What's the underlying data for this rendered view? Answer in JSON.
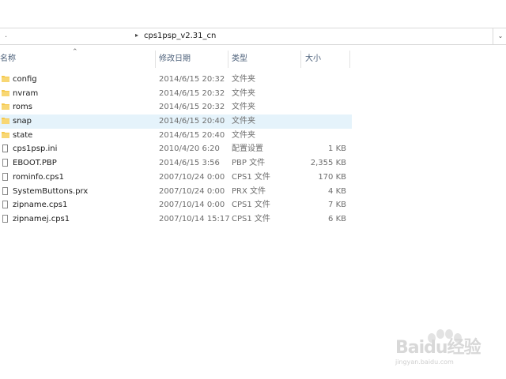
{
  "address": {
    "separator": ".",
    "path": "cps1psp_v2.31_cn"
  },
  "columns": {
    "name": "名称",
    "date": "修改日期",
    "type": "类型",
    "size": "大小"
  },
  "files": [
    {
      "name": "config",
      "date": "2014/6/15 20:32",
      "type": "文件夹",
      "size": "",
      "icon": "folder-icon"
    },
    {
      "name": "nvram",
      "date": "2014/6/15 20:32",
      "type": "文件夹",
      "size": "",
      "icon": "folder-icon"
    },
    {
      "name": "roms",
      "date": "2014/6/15 20:32",
      "type": "文件夹",
      "size": "",
      "icon": "folder-icon"
    },
    {
      "name": "snap",
      "date": "2014/6/15 20:40",
      "type": "文件夹",
      "size": "",
      "icon": "folder-icon"
    },
    {
      "name": "state",
      "date": "2014/6/15 20:40",
      "type": "文件夹",
      "size": "",
      "icon": "folder-icon"
    },
    {
      "name": "cps1psp.ini",
      "date": "2010/4/20 6:20",
      "type": "配置设置",
      "size": "1 KB",
      "icon": "settings-file-icon"
    },
    {
      "name": "EBOOT.PBP",
      "date": "2014/6/15 3:56",
      "type": "PBP 文件",
      "size": "2,355 KB",
      "icon": "file-icon"
    },
    {
      "name": "rominfo.cps1",
      "date": "2007/10/24 0:00",
      "type": "CPS1 文件",
      "size": "170 KB",
      "icon": "file-icon"
    },
    {
      "name": "SystemButtons.prx",
      "date": "2007/10/24 0:00",
      "type": "PRX 文件",
      "size": "4 KB",
      "icon": "file-icon"
    },
    {
      "name": "zipname.cps1",
      "date": "2007/10/14 0:00",
      "type": "CPS1 文件",
      "size": "7 KB",
      "icon": "file-icon"
    },
    {
      "name": "zipnamej.cps1",
      "date": "2007/10/14 15:17",
      "type": "CPS1 文件",
      "size": "6 KB",
      "icon": "file-icon"
    }
  ],
  "highlighted_row": "snap",
  "colors": {
    "hover_row": "#e5f3fb",
    "folder": "#f5c84c",
    "header_text": "#4c607a"
  },
  "watermark": {
    "main": "Baidu经验",
    "sub": "jingyan.baidu.com"
  }
}
